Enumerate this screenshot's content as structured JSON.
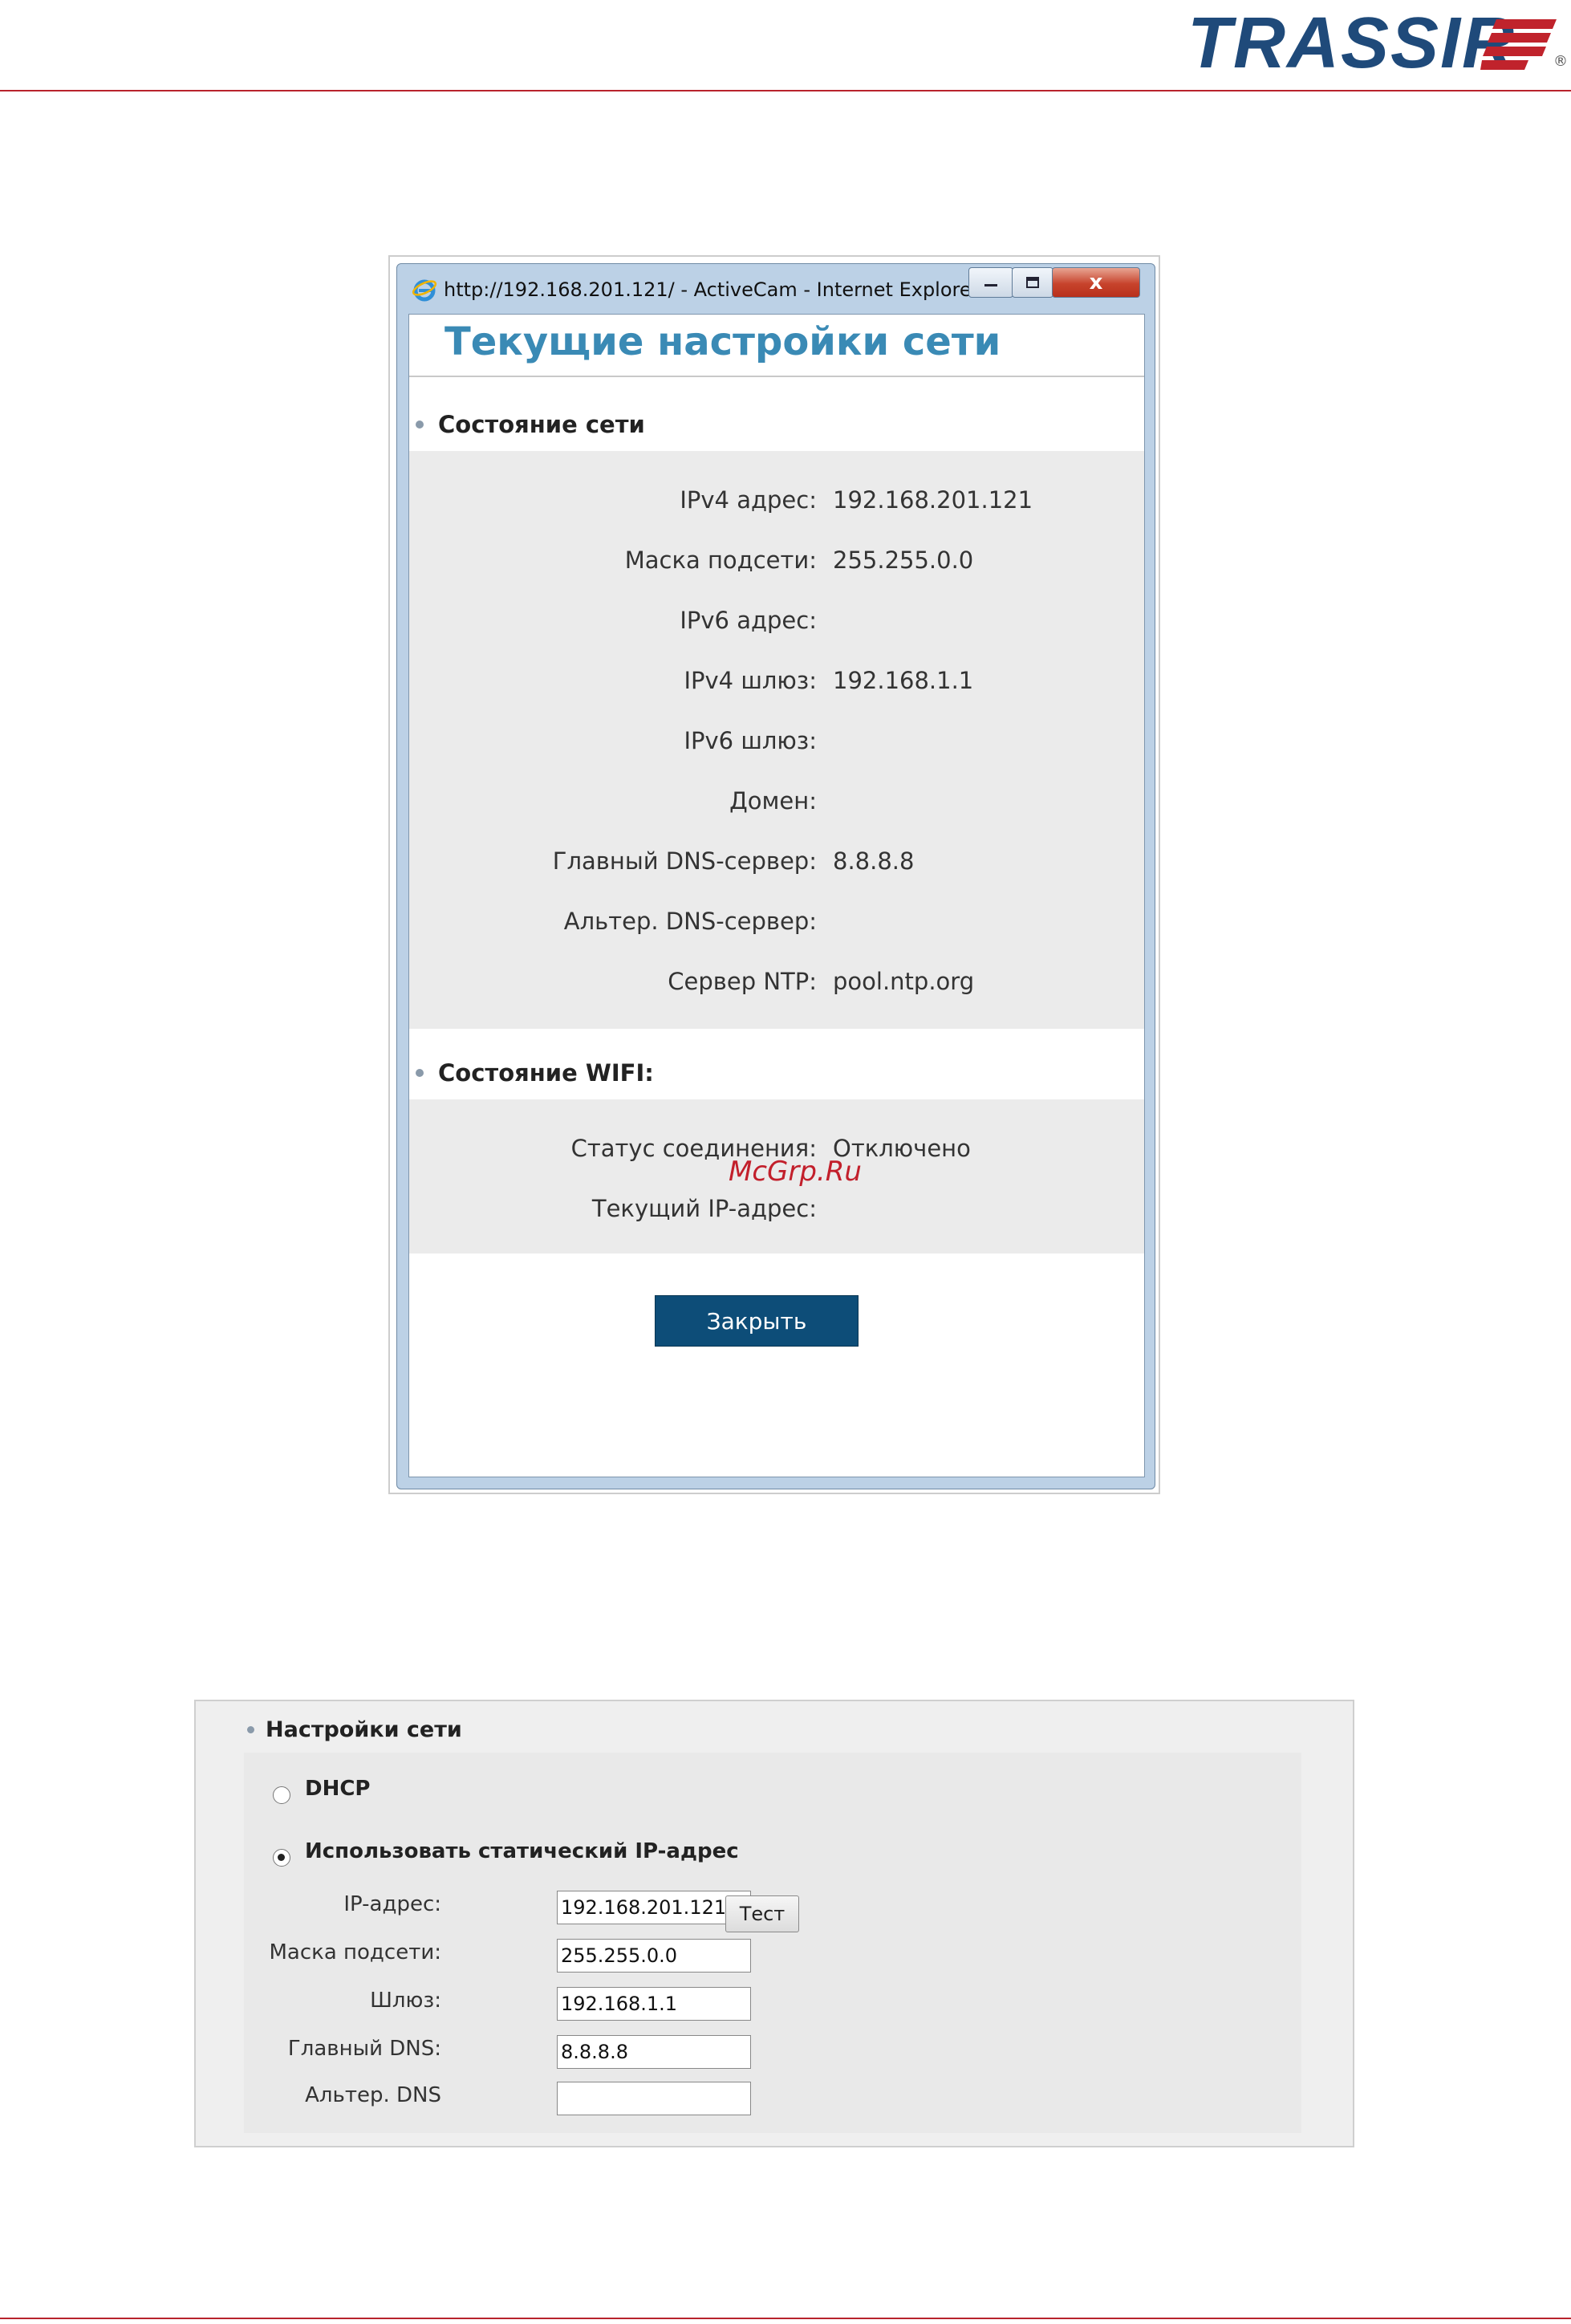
{
  "header": {
    "brand": "TRASSIR",
    "registered": "®"
  },
  "popup": {
    "window_title": "http://192.168.201.121/ - ActiveCam - Internet Explorer",
    "close_glyph": "x",
    "page_title": "Текущие настройки сети",
    "network_section": {
      "heading": "Состояние сети",
      "rows": [
        {
          "label": "IPv4 адрес:",
          "value": "192.168.201.121"
        },
        {
          "label": "Маска подсети:",
          "value": "255.255.0.0"
        },
        {
          "label": "IPv6 адрес:",
          "value": ""
        },
        {
          "label": "IPv4 шлюз:",
          "value": "192.168.1.1"
        },
        {
          "label": "IPv6 шлюз:",
          "value": ""
        },
        {
          "label": "Домен:",
          "value": ""
        },
        {
          "label": "Главный DNS-сервер:",
          "value": "8.8.8.8"
        },
        {
          "label": "Альтер. DNS-сервер:",
          "value": ""
        },
        {
          "label": "Сервер NTP:",
          "value": "pool.ntp.org"
        }
      ]
    },
    "wifi_section": {
      "heading": "Состояние WIFI:",
      "rows": [
        {
          "label": "Статус соединения:",
          "value": "Отключено"
        },
        {
          "label": "Текущий IP-адрес:",
          "value": ""
        }
      ]
    },
    "close_button": "Закрыть",
    "watermark": "McGrp.Ru"
  },
  "settings": {
    "heading": "Настройки сети",
    "dhcp_label": "DHCP",
    "static_label": "Использовать статический IP-адрес",
    "selected": "static",
    "fields": [
      {
        "label": "IP-адрес:",
        "value": "192.168.201.121"
      },
      {
        "label": "Маска подсети:",
        "value": "255.255.0.0"
      },
      {
        "label": "Шлюз:",
        "value": "192.168.1.1"
      },
      {
        "label": "Главный DNS:",
        "value": "8.8.8.8"
      },
      {
        "label": "Альтер. DNS",
        "value": ""
      }
    ],
    "test_button": "Тест"
  },
  "colors": {
    "accent_red": "#b8232c",
    "brand_blue": "#1f4a7a",
    "title_blue": "#3a8ab5",
    "button_blue": "#0d4d78"
  }
}
